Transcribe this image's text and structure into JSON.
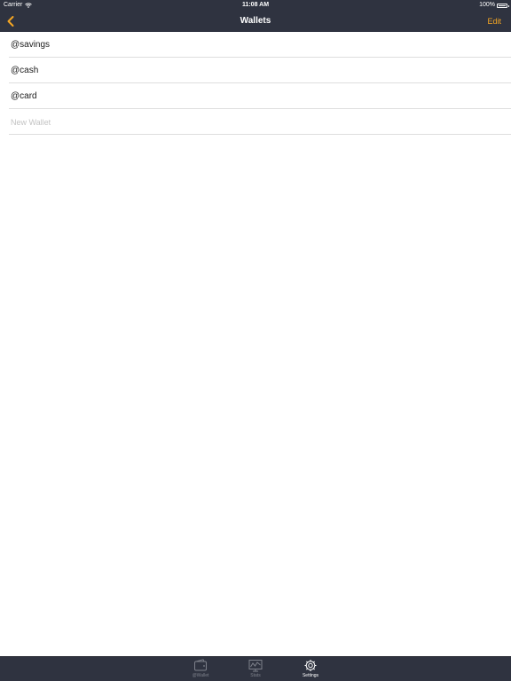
{
  "status_bar": {
    "carrier": "Carrier",
    "time": "11:08 AM",
    "battery": "100%",
    "battery_level": 1.0
  },
  "nav": {
    "title": "Wallets",
    "edit_label": "Edit",
    "back_icon": "chevron-left-icon"
  },
  "wallets": [
    "@savings",
    "@cash",
    "@card"
  ],
  "new_wallet": {
    "placeholder": "New Wallet",
    "value": ""
  },
  "tabs": [
    {
      "label": "@Wallet",
      "icon": "wallet-icon",
      "active": false
    },
    {
      "label": "Stats",
      "icon": "stats-icon",
      "active": false
    },
    {
      "label": "Settings",
      "icon": "gear-icon",
      "active": true
    }
  ],
  "colors": {
    "bar": "#2f3340",
    "accent": "#f5a623",
    "separator": "#dedede",
    "placeholder": "#c3c3c3",
    "tab_inactive": "#7d808a",
    "tab_active": "#ffffff"
  }
}
